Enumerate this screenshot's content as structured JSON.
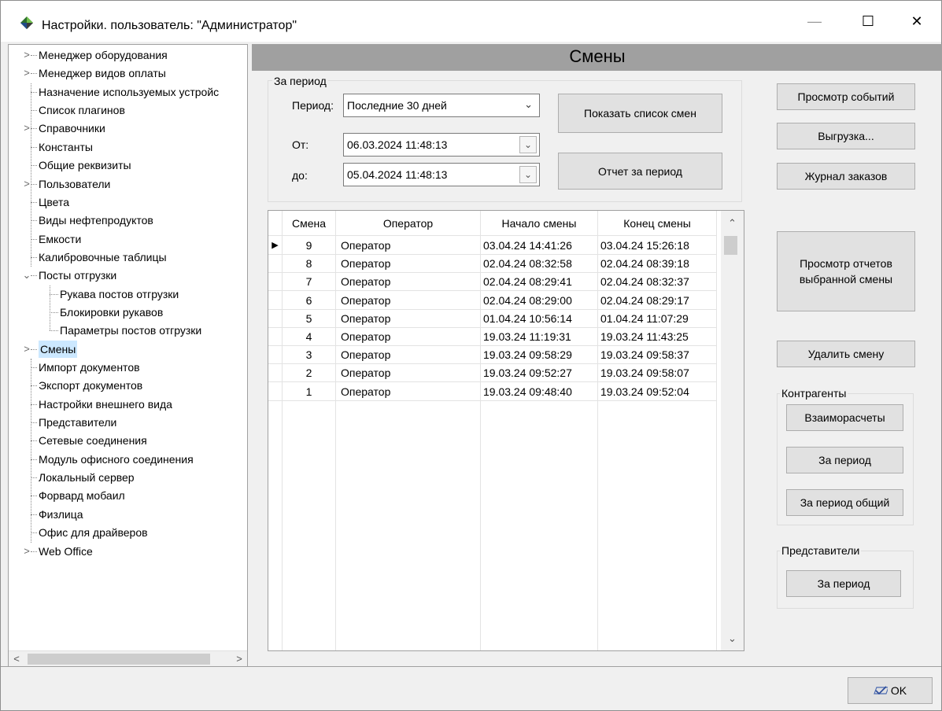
{
  "window": {
    "title": "Настройки. пользователь: \"Администратор\"",
    "minimize": "—",
    "maximize": "☐",
    "close": "✕"
  },
  "tree": {
    "items": [
      {
        "label": "Менеджер оборудования",
        "expander": ">"
      },
      {
        "label": "Менеджер видов оплаты",
        "expander": ">"
      },
      {
        "label": "Назначение используемых устройс",
        "expander": ""
      },
      {
        "label": "Список плагинов",
        "expander": ""
      },
      {
        "label": "Справочники",
        "expander": ">"
      },
      {
        "label": "Константы",
        "expander": ""
      },
      {
        "label": "Общие реквизиты",
        "expander": ""
      },
      {
        "label": "Пользователи",
        "expander": ">"
      },
      {
        "label": "Цвета",
        "expander": ""
      },
      {
        "label": "Виды нефтепродуктов",
        "expander": ""
      },
      {
        "label": "Емкости",
        "expander": ""
      },
      {
        "label": "Калибровочные таблицы",
        "expander": ""
      },
      {
        "label": "Посты отгрузки",
        "expander": "v"
      },
      {
        "label": "Рукава постов отгрузки",
        "expander": "",
        "child": true
      },
      {
        "label": "Блокировки рукавов",
        "expander": "",
        "child": true
      },
      {
        "label": "Параметры постов отгрузки",
        "expander": "",
        "child": true
      },
      {
        "label": "Смены",
        "expander": ">",
        "selected": true
      },
      {
        "label": "Импорт документов",
        "expander": ""
      },
      {
        "label": "Экспорт документов",
        "expander": ""
      },
      {
        "label": "Настройки внешнего вида",
        "expander": ""
      },
      {
        "label": "Представители",
        "expander": ""
      },
      {
        "label": "Сетевые соединения",
        "expander": ""
      },
      {
        "label": "Модуль офисного соединения",
        "expander": ""
      },
      {
        "label": "Локальный сервер",
        "expander": ""
      },
      {
        "label": "Форвард мобаил",
        "expander": ""
      },
      {
        "label": "Физлица",
        "expander": ""
      },
      {
        "label": "Офис для драйверов",
        "expander": ""
      },
      {
        "label": "Web Office",
        "expander": ">"
      }
    ]
  },
  "header": {
    "title": "Смены"
  },
  "period_group": {
    "title": "За период",
    "period_label": "Период:",
    "period_value": "Последние 30 дней",
    "from_label": "От:",
    "from_value": "06.03.2024 11:48:13",
    "to_label": "до:",
    "to_value": "05.04.2024 11:48:13",
    "show_shifts_button": "Показать список смен",
    "period_report_button": "Отчет за период"
  },
  "grid": {
    "columns": [
      "Смена",
      "Оператор",
      "Начало смены",
      "Конец смены"
    ],
    "rows": [
      [
        "9",
        "Оператор",
        "03.04.24 14:41:26",
        "03.04.24 15:26:18"
      ],
      [
        "8",
        "Оператор",
        "02.04.24 08:32:58",
        "02.04.24 08:39:18"
      ],
      [
        "7",
        "Оператор",
        "02.04.24 08:29:41",
        "02.04.24 08:32:37"
      ],
      [
        "6",
        "Оператор",
        "02.04.24 08:29:00",
        "02.04.24 08:29:17"
      ],
      [
        "5",
        "Оператор",
        "01.04.24 10:56:14",
        "01.04.24 11:07:29"
      ],
      [
        "4",
        "Оператор",
        "19.03.24 11:19:31",
        "19.03.24 11:43:25"
      ],
      [
        "3",
        "Оператор",
        "19.03.24 09:58:29",
        "19.03.24 09:58:37"
      ],
      [
        "2",
        "Оператор",
        "19.03.24 09:52:27",
        "19.03.24 09:58:07"
      ],
      [
        "1",
        "Оператор",
        "19.03.24 09:48:40",
        "19.03.24 09:52:04"
      ]
    ],
    "current_row_marker": "▶"
  },
  "side": {
    "view_events": "Просмотр событий",
    "export": "Выгрузка...",
    "orders_log": "Журнал заказов",
    "view_reports": "Просмотр отчетов выбранной смены",
    "delete_shift": "Удалить смену",
    "contractors_title": "Контрагенты",
    "settlements": "Взаиморасчеты",
    "contr_period": "За период",
    "contr_period_total": "За период общий",
    "reps_title": "Представители",
    "reps_period": "За период"
  },
  "footer": {
    "ok": "OK"
  }
}
